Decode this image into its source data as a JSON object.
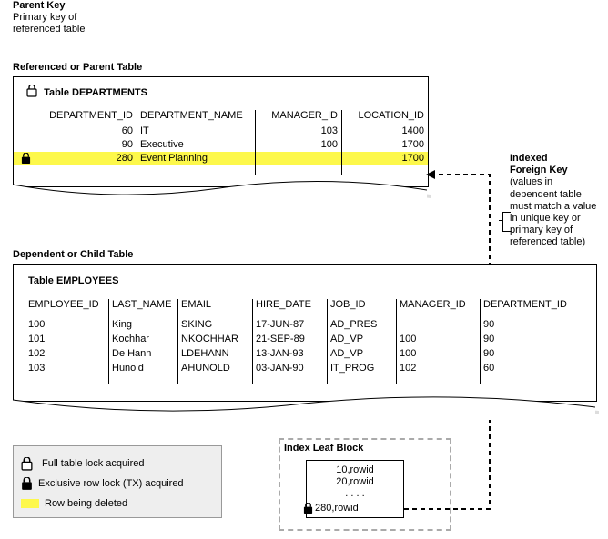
{
  "parent_key": {
    "line1": "Parent Key",
    "line2": "Primary key of",
    "line3": "referenced table"
  },
  "sections": {
    "parent_header": "Referenced or Parent Table",
    "child_header": "Dependent or Child Table"
  },
  "dep_table": {
    "title": "Table DEPARTMENTS",
    "cols": [
      "DEPARTMENT_ID",
      "DEPARTMENT_NAME",
      "MANAGER_ID",
      "LOCATION_ID"
    ],
    "rows": [
      {
        "id": "60",
        "name": "IT",
        "mgr": "103",
        "loc": "1400"
      },
      {
        "id": "90",
        "name": "Executive",
        "mgr": "100",
        "loc": "1700"
      },
      {
        "id": "280",
        "name": "Event Planning",
        "mgr": "",
        "loc": "1700"
      }
    ]
  },
  "fk_label": {
    "line1": "Indexed",
    "line2": "Foreign Key",
    "line3": "(values in dependent table must match a value in unique key or primary key of referenced table)"
  },
  "emp_table": {
    "title": "Table EMPLOYEES",
    "cols": [
      "EMPLOYEE_ID",
      "LAST_NAME",
      "EMAIL",
      "HIRE_DATE",
      "JOB_ID",
      "MANAGER_ID",
      "DEPARTMENT_ID"
    ],
    "rows": [
      {
        "id": "100",
        "ln": "King",
        "em": "SKING",
        "hd": "17-JUN-87",
        "job": "AD_PRES",
        "mgr": "",
        "dep": "90"
      },
      {
        "id": "101",
        "ln": "Kochhar",
        "em": "NKOCHHAR",
        "hd": "21-SEP-89",
        "job": "AD_VP",
        "mgr": "100",
        "dep": "90"
      },
      {
        "id": "102",
        "ln": "De Hann",
        "em": "LDEHANN",
        "hd": "13-JAN-93",
        "job": "AD_VP",
        "mgr": "100",
        "dep": "90"
      },
      {
        "id": "103",
        "ln": "Hunold",
        "em": "AHUNOLD",
        "hd": "03-JAN-90",
        "job": "IT_PROG",
        "mgr": "102",
        "dep": "60"
      }
    ]
  },
  "legend": {
    "full": "Full table lock acquired",
    "excl": "Exclusive row lock (TX) acquired",
    "del": "Row being deleted"
  },
  "index_block": {
    "title": "Index Leaf Block",
    "r1": "10,rowid",
    "r2": "20,rowid",
    "dots": ". . . .",
    "r3": "280,rowid"
  },
  "chart_data": {
    "type": "table",
    "parent_table": {
      "name": "DEPARTMENTS",
      "columns": [
        "DEPARTMENT_ID",
        "DEPARTMENT_NAME",
        "MANAGER_ID",
        "LOCATION_ID"
      ],
      "primary_key": "DEPARTMENT_ID",
      "locks": {
        "table": "full",
        "rows": {
          "280": "exclusive"
        }
      },
      "deleting_row_id": "280",
      "rows": [
        {
          "DEPARTMENT_ID": 60,
          "DEPARTMENT_NAME": "IT",
          "MANAGER_ID": 103,
          "LOCATION_ID": 1400
        },
        {
          "DEPARTMENT_ID": 90,
          "DEPARTMENT_NAME": "Executive",
          "MANAGER_ID": 100,
          "LOCATION_ID": 1700
        },
        {
          "DEPARTMENT_ID": 280,
          "DEPARTMENT_NAME": "Event Planning",
          "MANAGER_ID": null,
          "LOCATION_ID": 1700
        }
      ]
    },
    "child_table": {
      "name": "EMPLOYEES",
      "columns": [
        "EMPLOYEE_ID",
        "LAST_NAME",
        "EMAIL",
        "HIRE_DATE",
        "JOB_ID",
        "MANAGER_ID",
        "DEPARTMENT_ID"
      ],
      "foreign_key": {
        "column": "DEPARTMENT_ID",
        "references": "DEPARTMENTS.DEPARTMENT_ID",
        "indexed": true
      },
      "rows": [
        {
          "EMPLOYEE_ID": 100,
          "LAST_NAME": "King",
          "EMAIL": "SKING",
          "HIRE_DATE": "17-JUN-87",
          "JOB_ID": "AD_PRES",
          "MANAGER_ID": null,
          "DEPARTMENT_ID": 90
        },
        {
          "EMPLOYEE_ID": 101,
          "LAST_NAME": "Kochhar",
          "EMAIL": "NKOCHHAR",
          "HIRE_DATE": "21-SEP-89",
          "JOB_ID": "AD_VP",
          "MANAGER_ID": 100,
          "DEPARTMENT_ID": 90
        },
        {
          "EMPLOYEE_ID": 102,
          "LAST_NAME": "De Hann",
          "EMAIL": "LDEHANN",
          "HIRE_DATE": "13-JAN-93",
          "JOB_ID": "AD_VP",
          "MANAGER_ID": 100,
          "DEPARTMENT_ID": 90
        },
        {
          "EMPLOYEE_ID": 103,
          "LAST_NAME": "Hunold",
          "EMAIL": "AHUNOLD",
          "HIRE_DATE": "03-JAN-90",
          "JOB_ID": "IT_PROG",
          "MANAGER_ID": 102,
          "DEPARTMENT_ID": 60
        }
      ]
    },
    "index_leaf_block": {
      "entries": [
        "10,rowid",
        "20,rowid",
        "...",
        "280,rowid"
      ],
      "locked_entry": "280,rowid",
      "lock_type": "exclusive"
    }
  }
}
